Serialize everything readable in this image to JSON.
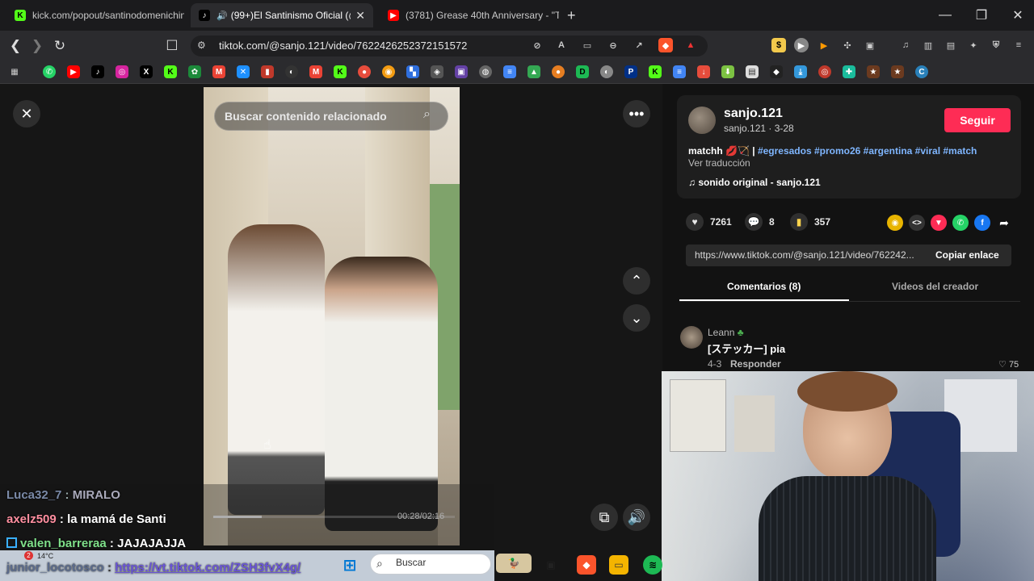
{
  "tabs": [
    {
      "title": "kick.com/popout/santinodomenichin",
      "favicon": "kick-icon",
      "color": "#53fc18",
      "glyph": "K"
    },
    {
      "title": "(99+)El Santinismo Oficial (@",
      "favicon": "tiktok-icon",
      "color": "#000000",
      "glyph": "♪",
      "active": true
    },
    {
      "title": "(3781) Grease 40th Anniversary - \"Th",
      "favicon": "youtube-icon",
      "color": "#ff0000",
      "glyph": "▶"
    }
  ],
  "address": {
    "url": "tiktok.com/@sanjo.121/video/7622426252372151572"
  },
  "video": {
    "search_placeholder": "Buscar contenido relacionado",
    "time": "00:28/02:16",
    "progress": 0.2
  },
  "post": {
    "username": "sanjo.121",
    "subline": "sanjo.121 · 3-28",
    "follow_label": "Seguir",
    "caption_prefix": "matchh 💋🏹 |",
    "hashtags": "#egresados #promo26 #argentina #viral #match",
    "translate": "Ver traducción",
    "sound": "sonido original - sanjo.121",
    "likes": "7261",
    "comments": "8",
    "saves": "357",
    "link": "https://www.tiktok.com/@sanjo.121/video/762242...",
    "copy_label": "Copiar enlace",
    "tab_comments": "Comentarios (8)",
    "tab_creator": "Videos del creador"
  },
  "comment": {
    "author": "Leann",
    "text": "[ステッカー] pia",
    "date": "4-3",
    "reply": "Responder",
    "likes": "75"
  },
  "chat": [
    {
      "user": "Luca32_7",
      "msg": "MIRALO",
      "color": "#7a8aa8"
    },
    {
      "user": "axelz509",
      "msg": "la mamá de Santi",
      "color": "#ff8fa0"
    },
    {
      "user": "valen_barreraa",
      "msg": "JAJAJAJJA",
      "color": "#7fe08a"
    },
    {
      "user": "junior_locotosco",
      "msg": "https://vt.tiktok.com/ZSH3fvX4g/",
      "color": "#7a8aa8"
    }
  ],
  "taskbar": {
    "search_label": "Buscar",
    "weather": "14°C",
    "badge": "2"
  }
}
